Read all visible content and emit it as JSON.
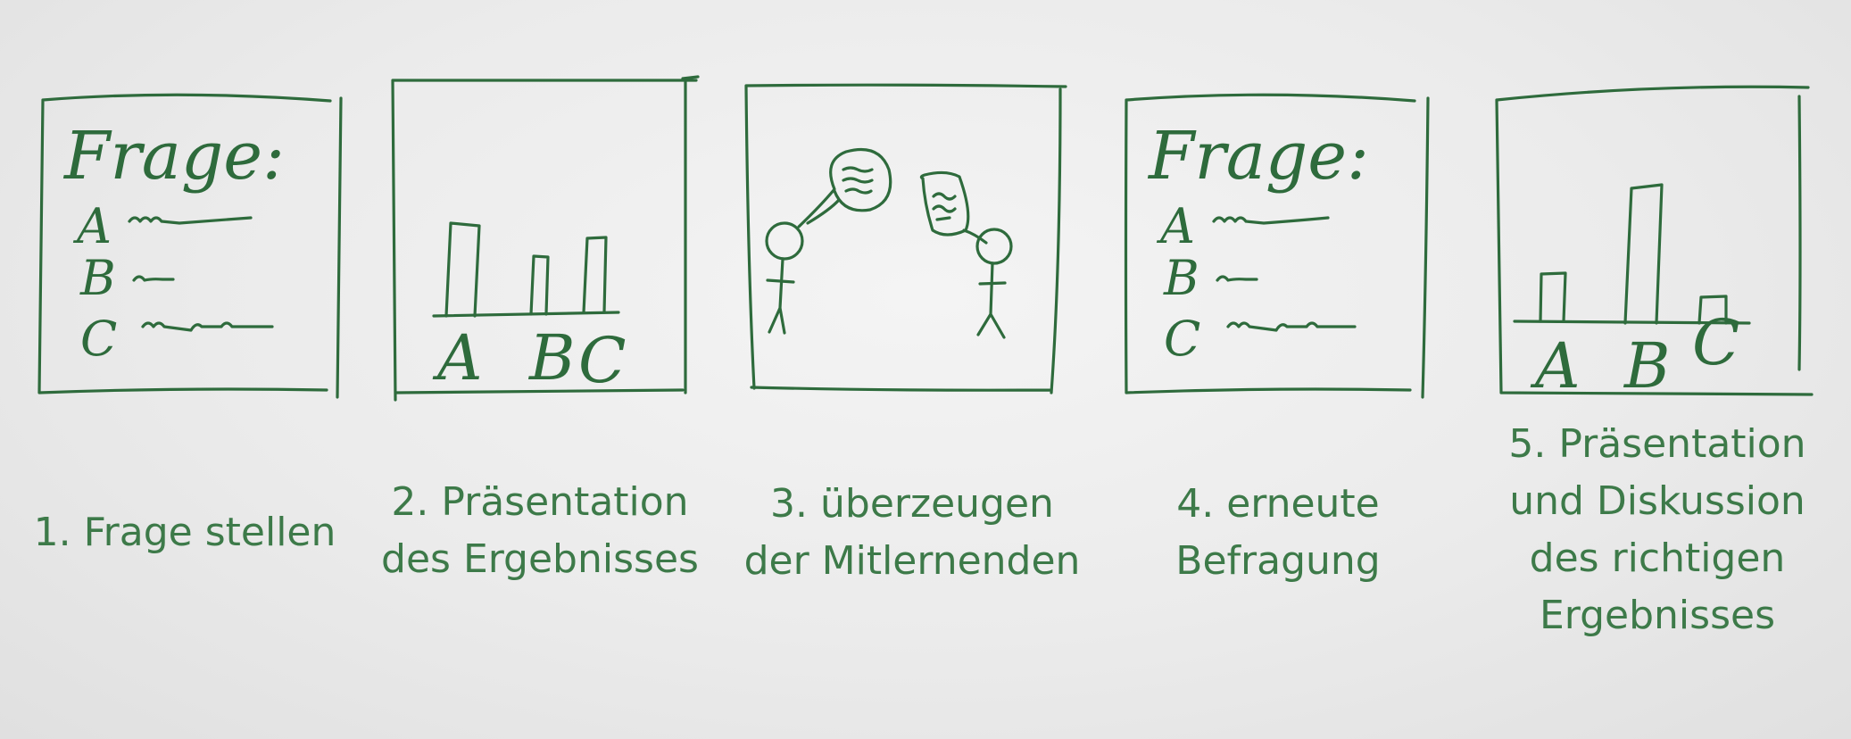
{
  "steps": [
    {
      "caption_lines": [
        "1. Frage stellen"
      ],
      "sketch": {
        "heading": "Frage:",
        "options": [
          "A",
          "B",
          "C"
        ]
      }
    },
    {
      "caption_lines": [
        "2. Präsentation",
        "des Ergebnisses"
      ],
      "sketch": {
        "bar_labels": [
          "A",
          "B",
          "C"
        ]
      }
    },
    {
      "caption_lines": [
        "3. überzeugen",
        "der Mitlernenden"
      ]
    },
    {
      "caption_lines": [
        "4. erneute",
        "Befragung"
      ],
      "sketch": {
        "heading": "Frage:",
        "options": [
          "A",
          "B",
          "C"
        ]
      }
    },
    {
      "caption_lines": [
        "5. Präsentation",
        "und Diskussion",
        "des richtigen",
        "Ergebnisses"
      ],
      "sketch": {
        "bar_labels": [
          "A",
          "B",
          "C"
        ]
      }
    }
  ],
  "colors": {
    "ink": "#2e6b3c",
    "caption": "#3d7a49"
  }
}
